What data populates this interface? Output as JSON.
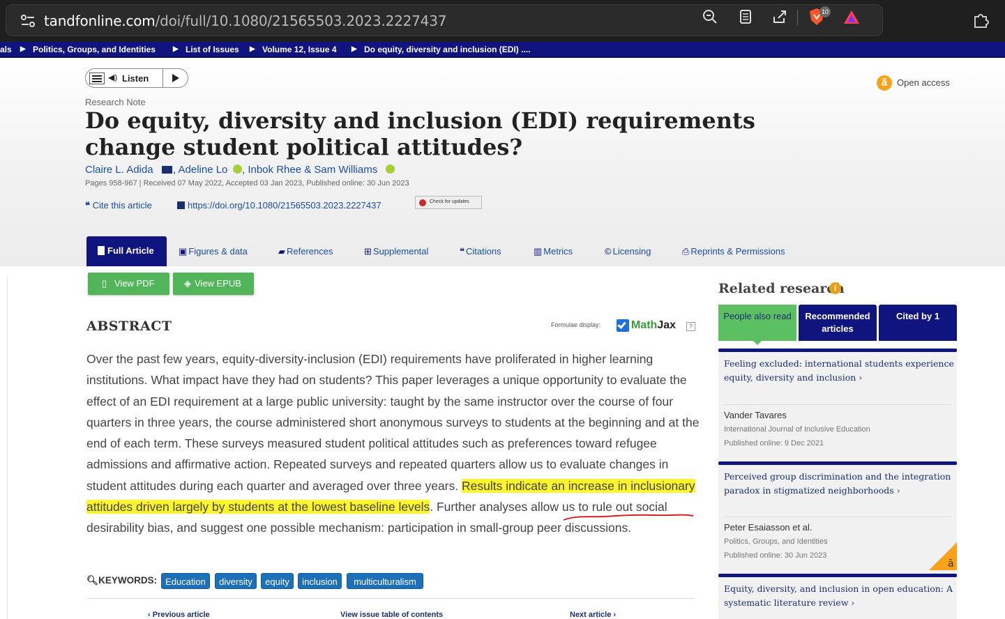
{
  "browser": {
    "url_host": "tandfonline.com",
    "url_path": "/doi/full/10.1080/21565503.2023.2227437",
    "brave_badge": "10"
  },
  "breadcrumb": [
    "als",
    "Politics, Groups, and Identities",
    "List of Issues",
    "Volume 12, Issue 4",
    "Do equity, diversity and inclusion (EDI) ...."
  ],
  "listen_label": "Listen",
  "open_access": "Open access",
  "article": {
    "type": "Research Note",
    "title": "Do equity, diversity and inclusion (EDI) requirements change student political attitudes?",
    "authors": [
      "Claire L. Adida",
      ", Adeline Lo",
      ", Inbok Rhee & Sam Williams"
    ],
    "pages_line": "Pages 958-967 | Received 07 May 2022, Accepted 03 Jan 2023, Published online: 30 Jun 2023",
    "cite": "Cite this article",
    "doi": "https://doi.org/10.1080/21565503.2023.2227437",
    "check_updates": "Check for updates"
  },
  "tabs": [
    {
      "label": "Full Article",
      "active": true
    },
    {
      "label": "Figures & data"
    },
    {
      "label": "References"
    },
    {
      "label": "Supplemental"
    },
    {
      "label": "Citations"
    },
    {
      "label": "Metrics"
    },
    {
      "label": "Licensing"
    },
    {
      "label": "Reprints & Permissions"
    }
  ],
  "buttons": {
    "pdf": "View PDF",
    "epub": "View EPUB"
  },
  "abstract": {
    "heading": "ABSTRACT",
    "formulae_label": "Formulae display:",
    "mathjax_a": "Math",
    "mathjax_b": "Jax",
    "text_before": "Over the past few years, equity-diversity-inclusion (EDI) requirements have proliferated in higher learning institutions. What impact have they had on students? This paper leverages a unique opportunity to evaluate the effect of an EDI requirement at a large public university: taught by the same instructor over the course of four quarters in three years, the course administered short anonymous surveys to students at the beginning and at the end of each term. These surveys measured student political attitudes such as preferences toward refugee admissions and affirmative action. Repeated surveys and repeated quarters allow us to evaluate changes in student attitudes during each quarter and averaged over three years. ",
    "text_highlight": "Results indicate an increase in inclusionary attitudes driven largely by students at the lowest baseline levels",
    "text_after": ". Further analyses allow us to rule out social desirability bias, and suggest one possible mechanism: participation in small-group peer discussions."
  },
  "keywords": {
    "label": "KEYWORDS:",
    "items": [
      "Education",
      "diversity",
      "equity",
      "inclusion",
      "multiculturalism"
    ]
  },
  "article_nav": {
    "prev": "Previous article",
    "toc": "View issue table of contents",
    "next": "Next article"
  },
  "related": {
    "heading": "Related research",
    "tabs": [
      {
        "label": "People also read",
        "active": true
      },
      {
        "label": "Recommended articles"
      },
      {
        "label": "Cited by 1"
      }
    ],
    "items": [
      {
        "title": "Feeling excluded: international students experience equity, diversity and inclusion",
        "author": "Vander Tavares",
        "journal": "International Journal of Inclusive Education",
        "published": "Published online: 9 Dec 2021"
      },
      {
        "title": "Perceived group discrimination and the integration paradox in stigmatized neighborhoods",
        "author": "Peter Esaiasson et al.",
        "journal": "Politics, Groups, and Identities",
        "published": "Published online: 30 Jun 2023"
      },
      {
        "title": "Equity, diversity, and inclusion in open education: A systematic literature review"
      }
    ]
  },
  "colors": {
    "brand_navy": "#10147e",
    "green": "#52b55a",
    "keyword_blue": "#1d6fb8",
    "highlight": "#fcf52a"
  }
}
